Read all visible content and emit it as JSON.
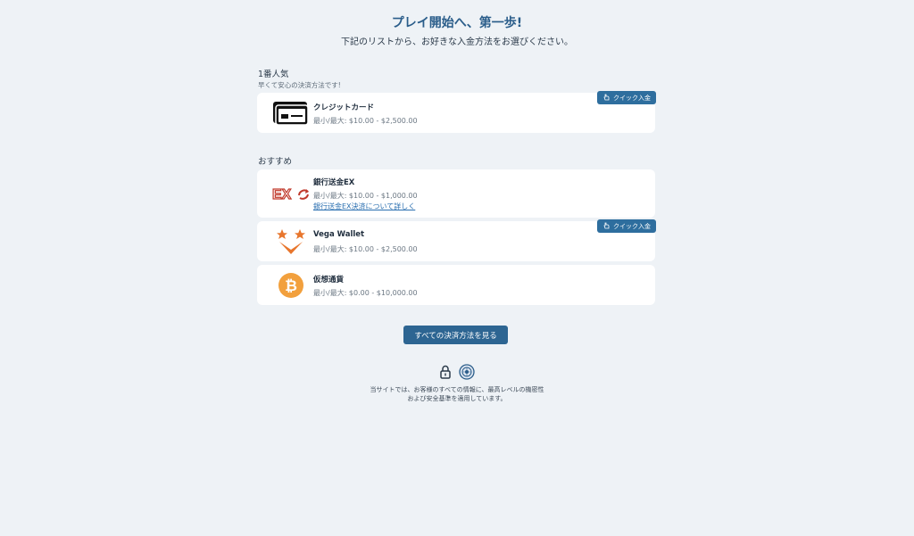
{
  "header": {
    "title": "プレイ開始へ、第一歩!",
    "subtitle": "下記のリストから、お好きな入金方法をお選びください。"
  },
  "popular": {
    "title": "1番人気",
    "subtitle": "早くて安心の決済方法です!",
    "methods": [
      {
        "name": "クレジットカード",
        "limit": "最小/最大: $10.00 - $2,500.00",
        "badge": "クイック入金",
        "icon": "credit-card-icon"
      }
    ]
  },
  "recommended": {
    "title": "おすすめ",
    "methods": [
      {
        "name": "銀行送金EX",
        "limit": "最小/最大: $10.00 - $1,000.00",
        "link": "銀行送金EX決済について詳しく",
        "logo_text": "EX",
        "icon": "bank-transfer-ex-logo"
      },
      {
        "name": "Vega Wallet",
        "limit": "最小/最大: $10.00 - $2,500.00",
        "badge": "クイック入金",
        "icon": "vega-wallet-logo"
      },
      {
        "name": "仮想通貨",
        "limit": "最小/最大: $0.00 - $10,000.00",
        "icon": "bitcoin-icon"
      }
    ]
  },
  "actions": {
    "all_methods": "すべての決済方法を見る"
  },
  "footer": {
    "line1": "当サイトでは、お客様のすべての情報に、最高レベルの機密性",
    "line2": "および安全基準を適用しています。"
  },
  "colors": {
    "accent": "#2d6592",
    "title": "#2a5d8a",
    "background": "#eef2f6",
    "bitcoin": "#f2a03d",
    "vega": "#e8762d",
    "ex_red": "#c0392b"
  }
}
